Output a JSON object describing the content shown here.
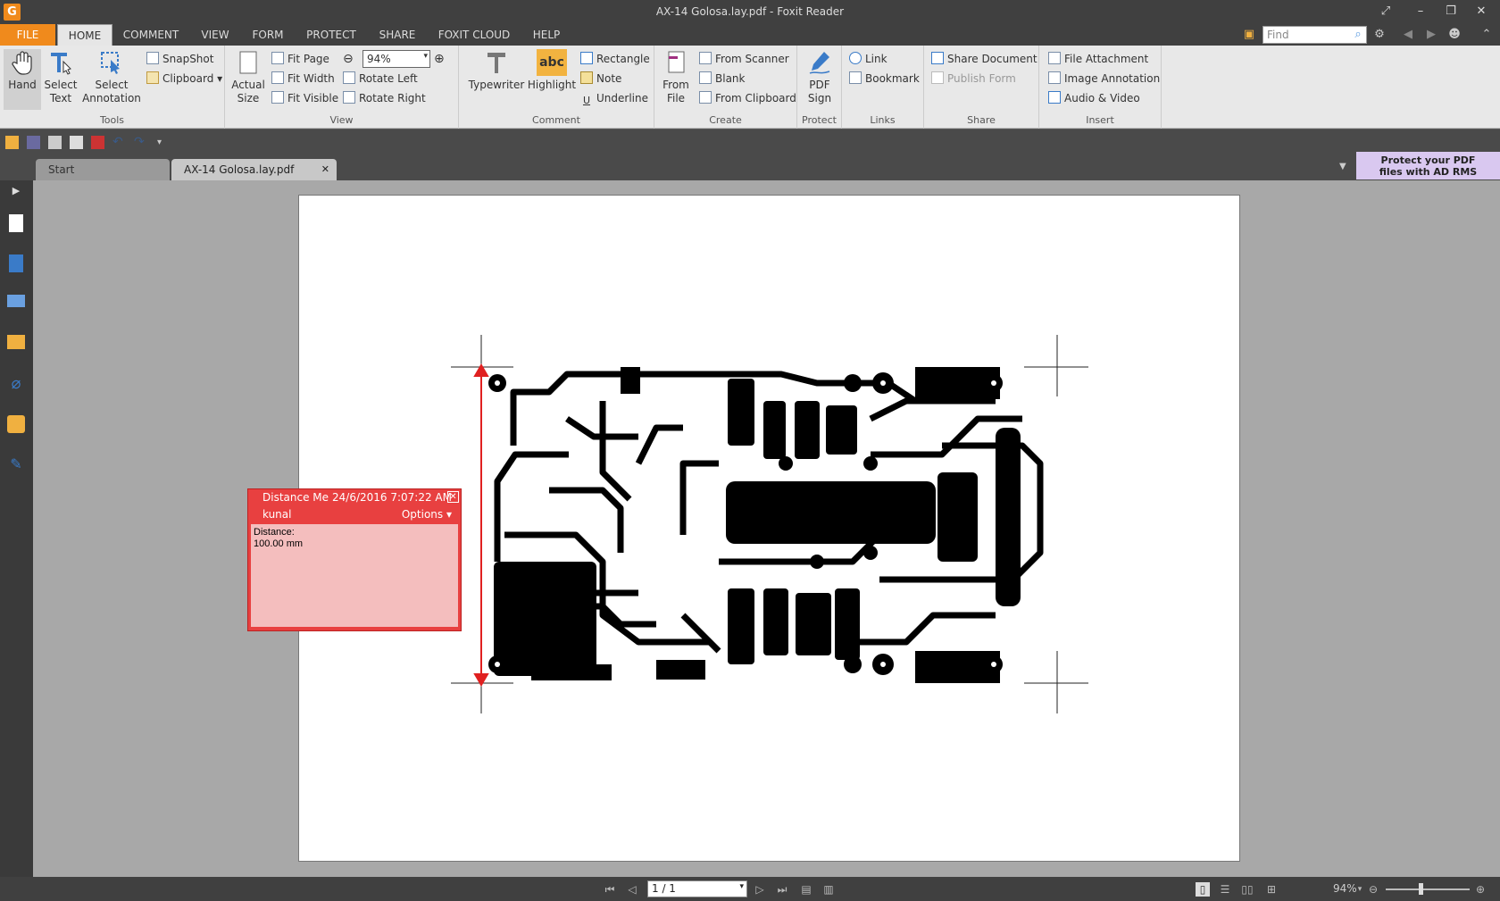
{
  "window": {
    "title": "AX-14 Golosa.lay.pdf - Foxit Reader",
    "app_icon": "G"
  },
  "menu": {
    "file": "FILE",
    "tabs": [
      "HOME",
      "COMMENT",
      "VIEW",
      "FORM",
      "PROTECT",
      "SHARE",
      "FOXIT CLOUD",
      "HELP"
    ],
    "find_placeholder": "Find"
  },
  "ribbon": {
    "tools": {
      "label": "Tools",
      "hand": "Hand",
      "select_text_1": "Select",
      "select_text_2": "Text",
      "select_annot_1": "Select",
      "select_annot_2": "Annotation",
      "snapshot": "SnapShot",
      "clipboard": "Clipboard"
    },
    "view": {
      "label": "View",
      "actual_1": "Actual",
      "actual_2": "Size",
      "fit_page": "Fit Page",
      "fit_width": "Fit Width",
      "fit_visible": "Fit Visible",
      "zoom": "94%",
      "rotate_left": "Rotate Left",
      "rotate_right": "Rotate Right"
    },
    "comment": {
      "label": "Comment",
      "typewriter": "Typewriter",
      "highlight": "Highlight",
      "highlight_icon": "abc",
      "rectangle": "Rectangle",
      "note": "Note",
      "underline": "Underline"
    },
    "create": {
      "label": "Create",
      "from_file_1": "From",
      "from_file_2": "File",
      "from_scanner": "From Scanner",
      "blank": "Blank",
      "from_clipboard": "From Clipboard"
    },
    "protect": {
      "label": "Protect",
      "pdf_sign_1": "PDF",
      "pdf_sign_2": "Sign"
    },
    "links": {
      "label": "Links",
      "link": "Link",
      "bookmark": "Bookmark"
    },
    "share": {
      "label": "Share",
      "share_document": "Share Document",
      "publish_form": "Publish Form"
    },
    "insert": {
      "label": "Insert",
      "file_attachment": "File Attachment",
      "image_annotation": "Image Annotation",
      "audio_video": "Audio & Video"
    }
  },
  "doctabs": {
    "start": "Start",
    "current": "AX-14 Golosa.lay.pdf"
  },
  "promo": {
    "line1": "Protect your PDF",
    "line2": "files with AD RMS"
  },
  "note": {
    "title": "Distance Me",
    "date": "24/6/2016 7:07:22 AM",
    "author": "kunal",
    "options": "Options",
    "body_line1": "Distance:",
    "body_line2": "100.00 mm"
  },
  "status": {
    "page": "1 / 1",
    "zoom": "94%"
  },
  "colors": {
    "accent": "#f08a1c",
    "note": "#e84040",
    "measure": "#e02020",
    "promo": "#d9c8f0"
  }
}
